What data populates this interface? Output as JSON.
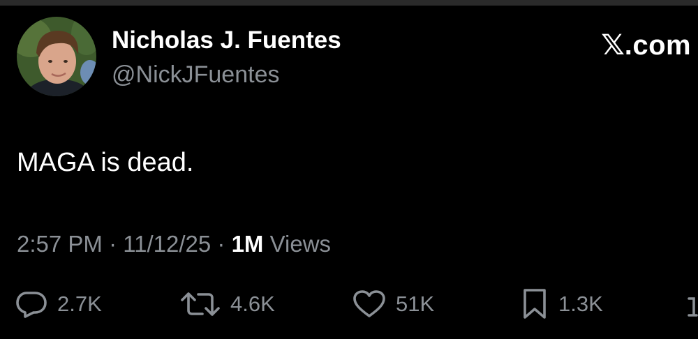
{
  "tweet": {
    "author": {
      "display_name": "Nicholas J. Fuentes",
      "handle": "@NickJFuentes"
    },
    "brand": "X.com",
    "brand_x": "𝕏",
    "brand_suffix": ".com",
    "text": "MAGA is dead.",
    "meta": {
      "time": "2:57 PM",
      "separator": " · ",
      "date": "11/12/25",
      "views_count": "1M",
      "views_label": " Views"
    },
    "actions": {
      "replies": "2.7K",
      "reposts": "4.6K",
      "likes": "51K",
      "bookmarks": "1.3K"
    },
    "icons": {
      "reply": "reply-icon",
      "repost": "repost-icon",
      "like": "heart-icon",
      "bookmark": "bookmark-icon",
      "share": "share-icon"
    },
    "colors": {
      "background": "#000000",
      "primary_text": "#ffffff",
      "secondary_text": "#8b9096"
    }
  }
}
